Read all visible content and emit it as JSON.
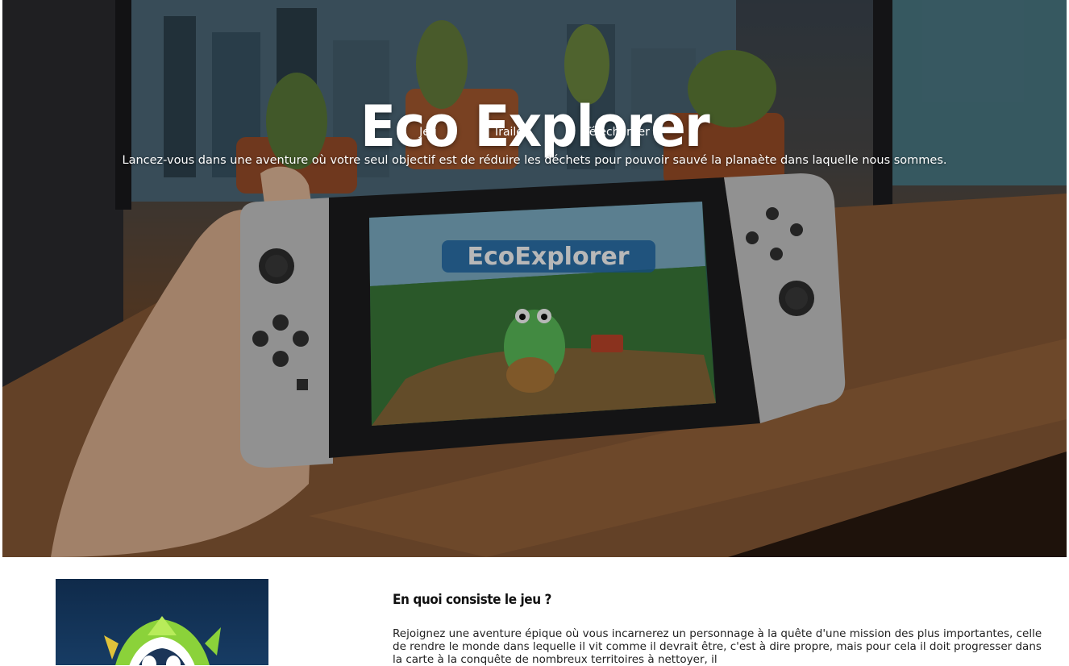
{
  "hero": {
    "title": "Eco Explorer",
    "nav": [
      "Jeu",
      "Trailer",
      "Télécharger"
    ],
    "tagline": "Lancez-vous dans une aventure où votre seul objectif est de réduire les déchets pour pouvoir sauvé la planaète dans laquelle nous sommes.",
    "screen_logo": "EcoExplorer"
  },
  "section": {
    "title": "En quoi consiste le jeu ?",
    "text": "Rejoignez une aventure épique où vous incarnerez un personnage à la quête d'une mission des plus importantes, celle de rendre le monde dans lequelle il vit comme il devrait être, c'est à dire propre, mais pour cela il doit progresser dans la carte à la conquête de nombreux territoires à nettoyer, il"
  },
  "colors": {
    "hero_text": "#ffffff",
    "logo_bg": "#173c64",
    "logo_green": "#8bd23a",
    "body_text": "#222222"
  },
  "icons": {
    "mascot": "eco-mascot-icon"
  }
}
